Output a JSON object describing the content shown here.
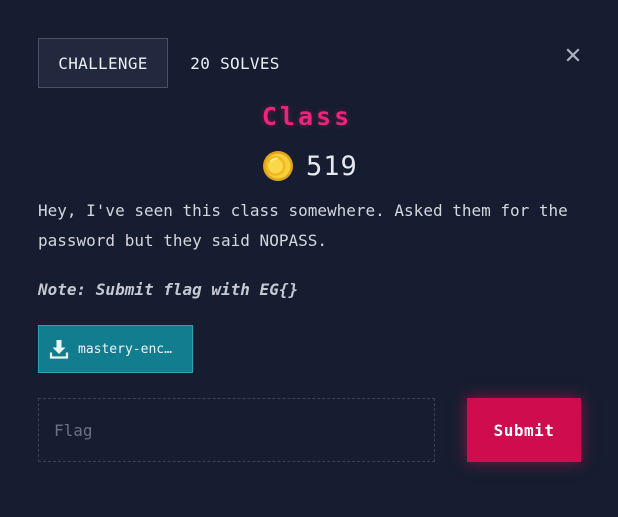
{
  "colors": {
    "background": "#171d30",
    "title": "#f0237a",
    "download_button": "#127d8e",
    "submit_button": "#cf0c4d",
    "coin": "#f2c12e"
  },
  "tabs": {
    "challenge_label": "CHALLENGE",
    "solves_label": "20 SOLVES"
  },
  "close_icon": "close-icon",
  "challenge": {
    "title": "Class",
    "value_icon": "coin-icon",
    "value": "519",
    "description": "Hey, I've seen this class somewhere. Asked them for the password but they said NOPASS.",
    "note": "Note: Submit flag with EG{}"
  },
  "file": {
    "icon": "download-icon",
    "name": "mastery-enc…"
  },
  "form": {
    "flag_placeholder": "Flag",
    "flag_value": "",
    "submit_label": "Submit"
  }
}
